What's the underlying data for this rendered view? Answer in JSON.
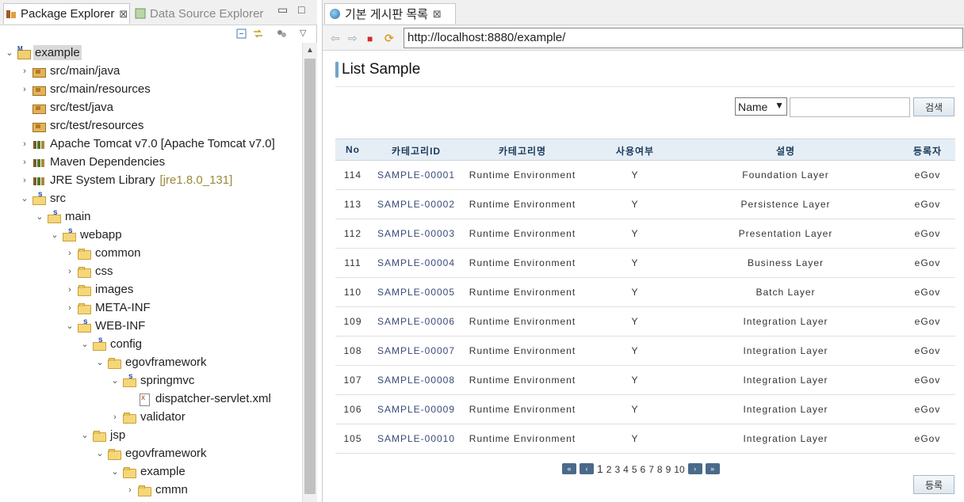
{
  "left_panel": {
    "tabs": [
      {
        "label": "Package Explorer",
        "close": "⊠"
      },
      {
        "label": "Data Source Explorer"
      }
    ],
    "window_buttons": {
      "minimize": "▭",
      "maximize": "□"
    },
    "tree": [
      {
        "label": "example",
        "indent": 0,
        "arrow": "⌄",
        "icon": "proj",
        "selected": true
      },
      {
        "label": "src/main/java",
        "indent": 1,
        "arrow": "›",
        "icon": "pkg"
      },
      {
        "label": "src/main/resources",
        "indent": 1,
        "arrow": "›",
        "icon": "pkg"
      },
      {
        "label": "src/test/java",
        "indent": 1,
        "arrow": "",
        "icon": "pkg"
      },
      {
        "label": "src/test/resources",
        "indent": 1,
        "arrow": "",
        "icon": "pkg"
      },
      {
        "label": "Apache Tomcat v7.0 [Apache Tomcat v7.0]",
        "indent": 1,
        "arrow": "›",
        "icon": "lib"
      },
      {
        "label": "Maven Dependencies",
        "indent": 1,
        "arrow": "›",
        "icon": "lib"
      },
      {
        "label": "JRE System Library",
        "deco": "[jre1.8.0_131]",
        "indent": 1,
        "arrow": "›",
        "icon": "lib"
      },
      {
        "label": "src",
        "indent": 1,
        "arrow": "⌄",
        "icon": "sfolder"
      },
      {
        "label": "main",
        "indent": 2,
        "arrow": "⌄",
        "icon": "sfolder"
      },
      {
        "label": "webapp",
        "indent": 3,
        "arrow": "⌄",
        "icon": "sfolder"
      },
      {
        "label": "common",
        "indent": 4,
        "arrow": "›",
        "icon": "folder"
      },
      {
        "label": "css",
        "indent": 4,
        "arrow": "›",
        "icon": "folder"
      },
      {
        "label": "images",
        "indent": 4,
        "arrow": "›",
        "icon": "folder"
      },
      {
        "label": "META-INF",
        "indent": 4,
        "arrow": "›",
        "icon": "folder"
      },
      {
        "label": "WEB-INF",
        "indent": 4,
        "arrow": "⌄",
        "icon": "sfolder"
      },
      {
        "label": "config",
        "indent": 5,
        "arrow": "⌄",
        "icon": "sfolder"
      },
      {
        "label": "egovframework",
        "indent": 6,
        "arrow": "⌄",
        "icon": "folder"
      },
      {
        "label": "springmvc",
        "indent": 7,
        "arrow": "⌄",
        "icon": "sfolder"
      },
      {
        "label": "dispatcher-servlet.xml",
        "indent": 8,
        "arrow": "",
        "icon": "xml"
      },
      {
        "label": "validator",
        "indent": 7,
        "arrow": "›",
        "icon": "folder"
      },
      {
        "label": "jsp",
        "indent": 5,
        "arrow": "⌄",
        "icon": "folder"
      },
      {
        "label": "egovframework",
        "indent": 6,
        "arrow": "⌄",
        "icon": "folder"
      },
      {
        "label": "example",
        "indent": 7,
        "arrow": "⌄",
        "icon": "folder"
      },
      {
        "label": "cmmn",
        "indent": 8,
        "arrow": "›",
        "icon": "folder"
      }
    ]
  },
  "right_panel": {
    "tab": {
      "label": "기본 게시판 목록",
      "close": "⊠"
    },
    "nav": {
      "back": "⇦",
      "forward": "⇨",
      "stop": "■",
      "refresh": "⟳"
    },
    "url": "http://localhost:8880/example/",
    "page": {
      "title": "List Sample",
      "search": {
        "select_value": "Name",
        "input_value": "",
        "button": "검색"
      },
      "table": {
        "headers": [
          "No",
          "카테고리ID",
          "카테고리명",
          "사용여부",
          "설명",
          "등록자"
        ],
        "rows": [
          [
            "114",
            "SAMPLE-00001",
            "Runtime Environment",
            "Y",
            "Foundation Layer",
            "eGov"
          ],
          [
            "113",
            "SAMPLE-00002",
            "Runtime Environment",
            "Y",
            "Persistence Layer",
            "eGov"
          ],
          [
            "112",
            "SAMPLE-00003",
            "Runtime Environment",
            "Y",
            "Presentation Layer",
            "eGov"
          ],
          [
            "111",
            "SAMPLE-00004",
            "Runtime Environment",
            "Y",
            "Business Layer",
            "eGov"
          ],
          [
            "110",
            "SAMPLE-00005",
            "Runtime Environment",
            "Y",
            "Batch Layer",
            "eGov"
          ],
          [
            "109",
            "SAMPLE-00006",
            "Runtime Environment",
            "Y",
            "Integration Layer",
            "eGov"
          ],
          [
            "108",
            "SAMPLE-00007",
            "Runtime Environment",
            "Y",
            "Integration Layer",
            "eGov"
          ],
          [
            "107",
            "SAMPLE-00008",
            "Runtime Environment",
            "Y",
            "Integration Layer",
            "eGov"
          ],
          [
            "106",
            "SAMPLE-00009",
            "Runtime Environment",
            "Y",
            "Integration Layer",
            "eGov"
          ],
          [
            "105",
            "SAMPLE-00010",
            "Runtime Environment",
            "Y",
            "Integration Layer",
            "eGov"
          ]
        ]
      },
      "pager": {
        "first": "«",
        "prev": "‹",
        "pages": [
          "1",
          "2",
          "3",
          "4",
          "5",
          "6",
          "7",
          "8",
          "9",
          "10"
        ],
        "current": "1",
        "next": "›",
        "last": "»"
      },
      "register_button": "등록"
    }
  }
}
